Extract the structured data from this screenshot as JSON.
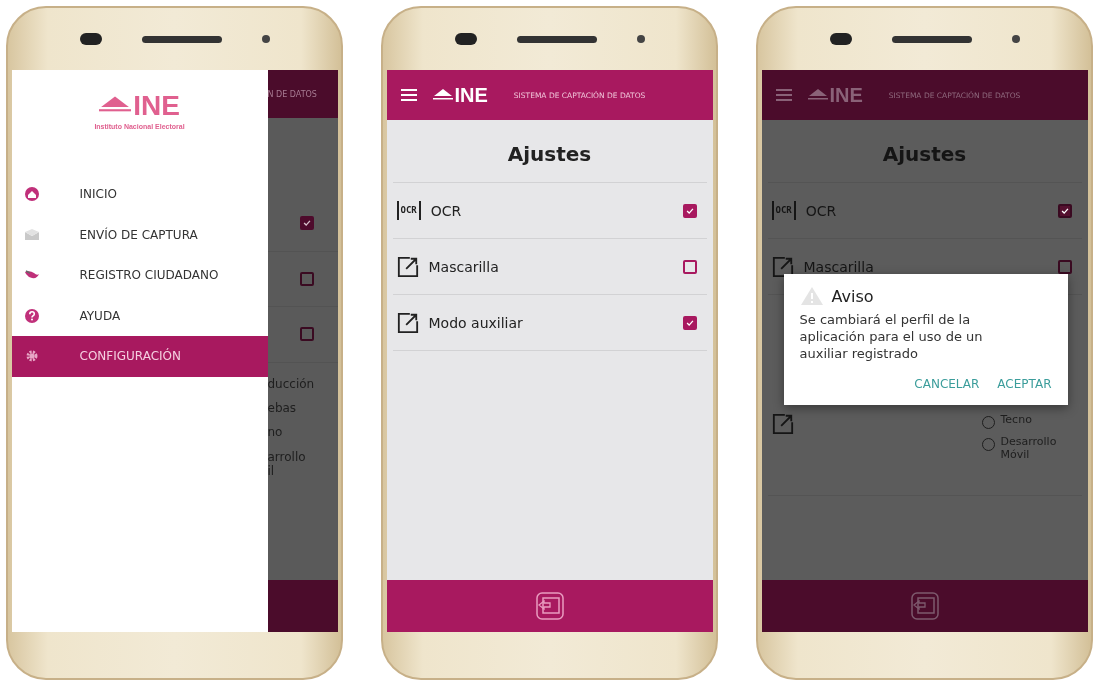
{
  "phones": [
    {
      "kind": "drawer",
      "background": {
        "header_text": "N DE DATOS",
        "checkboxes": [
          {
            "checked": true
          },
          {
            "checked": false
          },
          {
            "checked": false
          }
        ],
        "radio_labels": [
          "ducción",
          "ebas",
          "no",
          "arrollo il"
        ]
      },
      "drawer": {
        "logo": "INE",
        "logo_subtitle": "Instituto Nacional Electoral",
        "items": [
          {
            "label": "INICIO",
            "selected": false
          },
          {
            "label": "ENVÍO DE CAPTURA",
            "selected": false
          },
          {
            "label": "REGISTRO CIUDADANO",
            "selected": false
          },
          {
            "label": "AYUDA",
            "selected": false
          },
          {
            "label": "CONFIGURACIÓN",
            "selected": true
          }
        ]
      }
    },
    {
      "kind": "settings",
      "header": {
        "logo": "INE",
        "title": "SISTEMA DE CAPTACIÓN DE DATOS"
      },
      "page_title": "Ajustes",
      "settings": [
        {
          "kind": "ocr",
          "icon_text": "OCR",
          "label": "OCR",
          "checked": true
        },
        {
          "kind": "expand",
          "label": "Mascarilla",
          "checked": false
        },
        {
          "kind": "expand",
          "label": "Modo auxiliar",
          "checked": true
        }
      ]
    },
    {
      "kind": "dialog",
      "header": {
        "logo": "INE",
        "title": "SISTEMA DE CAPTACIÓN DE DATOS"
      },
      "page_title": "Ajustes",
      "settings": [
        {
          "kind": "ocr",
          "icon_text": "OCR",
          "label": "OCR",
          "checked": true
        },
        {
          "kind": "expand",
          "label": "Mascarilla",
          "checked": false
        }
      ],
      "radios": [
        {
          "label": "Tecno",
          "selected": false
        },
        {
          "label": "Desarrollo Móvil",
          "selected": false
        }
      ],
      "dialog": {
        "title": "Aviso",
        "message": "Se cambiará el perfil de la aplicación para el uso de un auxiliar registrado",
        "buttons": [
          "CANCELAR",
          "ACEPTAR"
        ]
      }
    }
  ]
}
